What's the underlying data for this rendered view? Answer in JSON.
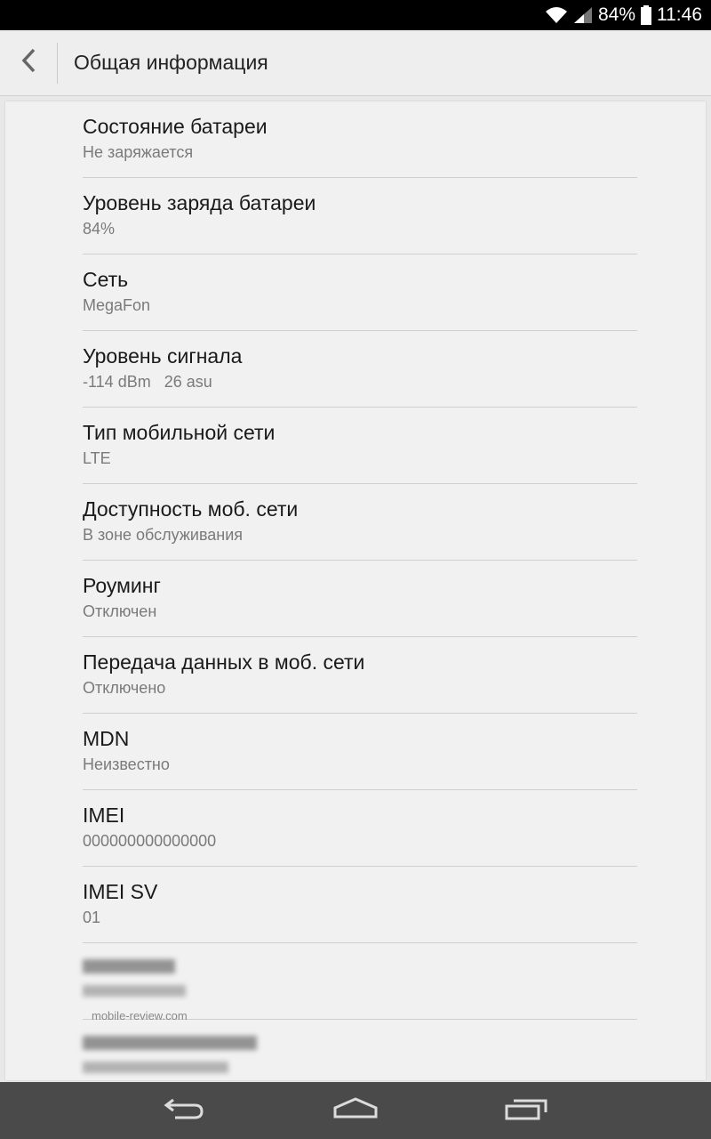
{
  "status_bar": {
    "battery_percent": "84%",
    "time": "11:46",
    "icons": [
      "wifi-icon",
      "signal-icon",
      "battery-icon"
    ]
  },
  "action_bar": {
    "title": "Общая информация",
    "back_icon": "back-chevron-icon"
  },
  "items": [
    {
      "title": "Состояние батареи",
      "value": "Не заряжается"
    },
    {
      "title": "Уровень заряда батареи",
      "value": "84%"
    },
    {
      "title": "Сеть",
      "value": "MegaFon"
    },
    {
      "title": "Уровень сигнала",
      "value": "-114 dBm   26 asu"
    },
    {
      "title": "Тип мобильной сети",
      "value": "LTE"
    },
    {
      "title": "Доступность моб. сети",
      "value": "В зоне обслуживания"
    },
    {
      "title": "Роуминг",
      "value": "Отключен"
    },
    {
      "title": "Передача данных в моб. сети",
      "value": "Отключено"
    },
    {
      "title": "MDN",
      "value": "Неизвестно"
    },
    {
      "title": "IMEI",
      "value": "000000000000000"
    },
    {
      "title": "IMEI SV",
      "value": "01"
    }
  ],
  "watermark": "mobile-review.com",
  "nav_bar": {
    "icons": [
      "back-icon",
      "home-icon",
      "recents-icon"
    ]
  }
}
